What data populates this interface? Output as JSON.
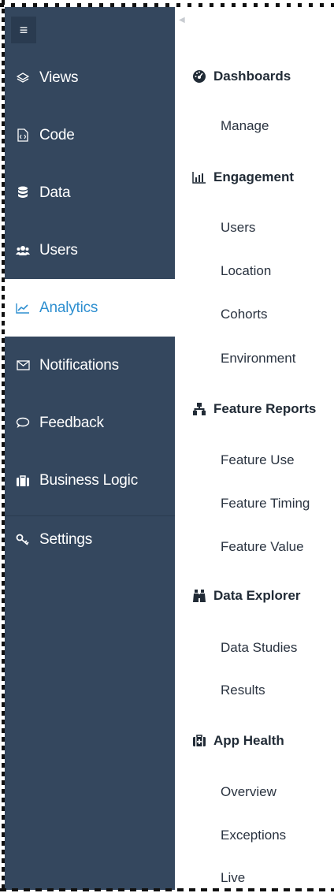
{
  "sidebar": {
    "toggle_icon": "hamburger-icon",
    "items": [
      {
        "label": "Views",
        "icon": "layers-icon"
      },
      {
        "label": "Code",
        "icon": "code-file-icon"
      },
      {
        "label": "Data",
        "icon": "database-icon"
      },
      {
        "label": "Users",
        "icon": "users-icon"
      },
      {
        "label": "Analytics",
        "icon": "line-chart-icon",
        "active": true
      },
      {
        "label": "Notifications",
        "icon": "envelope-icon"
      },
      {
        "label": "Feedback",
        "icon": "comment-icon"
      },
      {
        "label": "Business Logic",
        "icon": "briefcase-icon"
      },
      {
        "label": "Settings",
        "icon": "key-icon"
      }
    ],
    "active_color": "#2e8fd0",
    "background": "#34475e"
  },
  "submenu": {
    "collapse_icon": "caret-left-icon",
    "sections": [
      {
        "title": "Dashboards",
        "icon": "dashboard-icon",
        "items": [
          "Manage"
        ]
      },
      {
        "title": "Engagement",
        "icon": "bar-chart-icon",
        "items": [
          "Users",
          "Location",
          "Cohorts",
          "Environment"
        ]
      },
      {
        "title": "Feature Reports",
        "icon": "sitemap-icon",
        "items": [
          "Feature Use",
          "Feature Timing",
          "Feature Value"
        ]
      },
      {
        "title": "Data Explorer",
        "icon": "binoculars-icon",
        "items": [
          "Data Studies",
          "Results"
        ]
      },
      {
        "title": "App Health",
        "icon": "medkit-icon",
        "items": [
          "Overview",
          "Exceptions",
          "Live"
        ]
      }
    ]
  }
}
